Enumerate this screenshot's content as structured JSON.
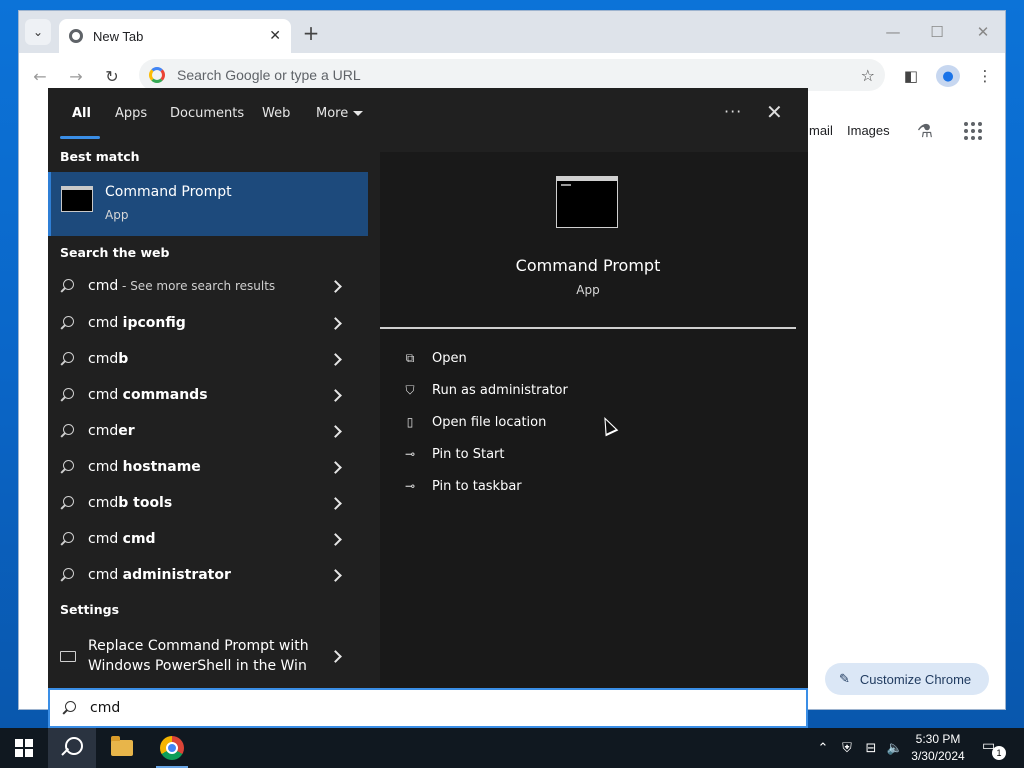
{
  "browser": {
    "tab_title": "New Tab",
    "new_tab_symbol": "+",
    "close_tab_symbol": "✕",
    "window_controls": {
      "minimize": "—",
      "maximize": "☐",
      "close": "✕"
    },
    "nav": {
      "back": "←",
      "forward": "→",
      "reload": "↻"
    },
    "omnibox_placeholder": "Search Google or type a URL",
    "ntp_links": {
      "gmail": "mail",
      "images": "Images"
    },
    "customize_label": "Customize Chrome",
    "icons": [
      "search-tabs-icon",
      "favicon-chrome-icon",
      "google-icon",
      "star-icon",
      "side-panel-icon",
      "profile-icon",
      "menu-icon",
      "labs-icon",
      "apps-icon",
      "pencil-icon"
    ]
  },
  "search_panel": {
    "tabs": [
      {
        "label": "All",
        "active": true
      },
      {
        "label": "Apps"
      },
      {
        "label": "Documents"
      },
      {
        "label": "Web"
      },
      {
        "label": "More"
      }
    ],
    "more_options": "···",
    "close": "✕",
    "best_match_heading": "Best match",
    "best_match": {
      "title": "Command Prompt",
      "subtitle": "App"
    },
    "web_heading": "Search the web",
    "web_results": [
      {
        "prefix": "cmd",
        "rest": "",
        "extra": " - See more search results"
      },
      {
        "prefix": "cmd ",
        "rest": "ipconfig",
        "extra": ""
      },
      {
        "prefix": "cmd",
        "rest": "b",
        "extra": ""
      },
      {
        "prefix": "cmd ",
        "rest": "commands",
        "extra": ""
      },
      {
        "prefix": "cmd",
        "rest": "er",
        "extra": ""
      },
      {
        "prefix": "cmd ",
        "rest": "hostname",
        "extra": ""
      },
      {
        "prefix": "cmd",
        "rest": "b tools",
        "extra": ""
      },
      {
        "prefix": "cmd ",
        "rest": "cmd",
        "extra": ""
      },
      {
        "prefix": "cmd ",
        "rest": "administrator",
        "extra": ""
      }
    ],
    "settings_heading": "Settings",
    "settings_item": {
      "line1": "Replace Command Prompt with",
      "line2": "Windows PowerShell in the Win"
    },
    "preview": {
      "title": "Command Prompt",
      "subtitle": "App",
      "actions": [
        {
          "label": "Open",
          "icon": "open-icon"
        },
        {
          "label": "Run as administrator",
          "icon": "shield-icon"
        },
        {
          "label": "Open file location",
          "icon": "file-location-icon"
        },
        {
          "label": "Pin to Start",
          "icon": "pin-icon"
        },
        {
          "label": "Pin to taskbar",
          "icon": "pin-icon"
        }
      ]
    },
    "search_query": "cmd"
  },
  "taskbar": {
    "apps": [
      "start-button",
      "search-button",
      "file-explorer",
      "chrome"
    ],
    "time": "5:30 PM",
    "date": "3/30/2024",
    "notification_count": "1"
  }
}
